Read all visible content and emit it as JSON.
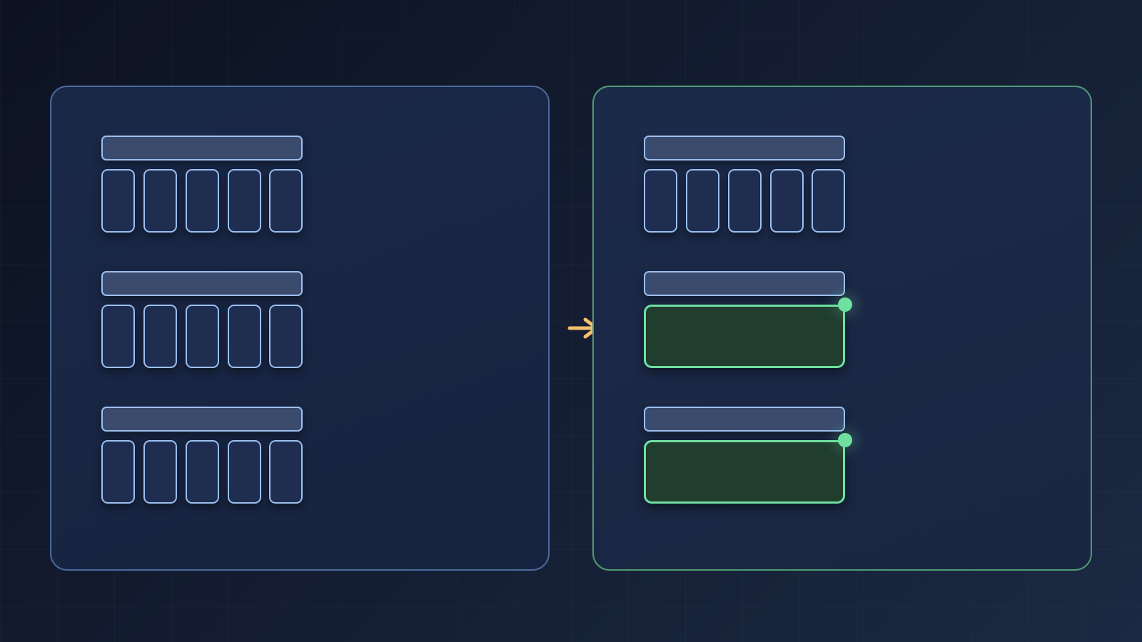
{
  "diagram": {
    "before_panel": {
      "groups": [
        {
          "header": "",
          "slot_count": 5
        },
        {
          "header": "",
          "slot_count": 5
        },
        {
          "header": "",
          "slot_count": 5
        }
      ]
    },
    "after_panel": {
      "groups": [
        {
          "header": "",
          "state": "separate",
          "slot_count": 5
        },
        {
          "header": "",
          "state": "merged"
        },
        {
          "header": "",
          "state": "merged"
        }
      ]
    },
    "transition_arrow": "right-arrow-icon",
    "colors": {
      "before_border": "#4a6a9c",
      "after_border": "#4f9c72",
      "slot_border": "#9cc0f2",
      "merged_border": "#6fe0a0",
      "merged_fill": "#203d2e",
      "arrow": "#f5c06c"
    }
  }
}
